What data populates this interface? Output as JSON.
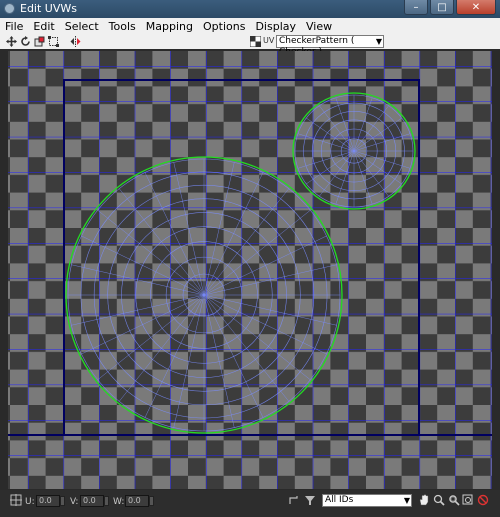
{
  "window": {
    "title": "Edit UVWs",
    "controls": [
      "minimize",
      "maximize",
      "close"
    ]
  },
  "menu": [
    "File",
    "Edit",
    "Select",
    "Tools",
    "Mapping",
    "Options",
    "Display",
    "View"
  ],
  "toolbar": {
    "tools": [
      "move-icon",
      "rotate-icon",
      "scale-icon",
      "freeform-icon",
      "mirror-icon"
    ],
    "uv_label": "UV",
    "texture_select": "CheckerPattern  ( Checker )"
  },
  "viewport": {
    "background": "checker",
    "checker_colors": {
      "light": "#7a7a7a",
      "dark": "#3c3c3c"
    },
    "grid_color": "#2222ff",
    "uv_boundary_color": "#000060",
    "seam_color": "#22dd22",
    "wire_color": "#7a8dff"
  },
  "bottom": {
    "u_label": "U:",
    "u_value": "0.0",
    "v_label": "V:",
    "v_value": "0.0",
    "w_label": "W:",
    "w_value": "0.0",
    "ids_select": "All IDs"
  }
}
